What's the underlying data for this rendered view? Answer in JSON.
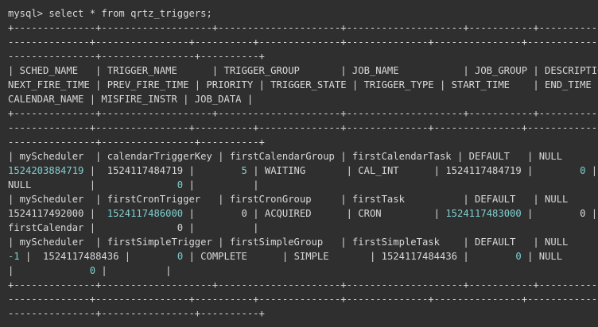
{
  "terminal": {
    "lines": [
      [
        {
          "text": "mysql> select * from qrtz_triggers;",
          "kind": "plain"
        }
      ],
      [
        {
          "text": "+--------------+-------------------+---------------------+--------------------+-----------+-------------+",
          "kind": "plain"
        }
      ],
      [
        {
          "text": "--------------+----------------+----------+--------------+--------------+---------------+---------------+",
          "kind": "plain"
        }
      ],
      [
        {
          "text": "---------------+----------------+----------+",
          "kind": "plain"
        }
      ],
      [
        {
          "text": "| SCHED_NAME   | TRIGGER_NAME      | TRIGGER_GROUP       | JOB_NAME           | JOB_GROUP | DESCRIPTION |",
          "kind": "plain"
        }
      ],
      [
        {
          "text": "NEXT_FIRE_TIME | PREV_FIRE_TIME | PRIORITY | TRIGGER_STATE | TRIGGER_TYPE | START_TIME    | END_TIME |",
          "kind": "plain"
        }
      ],
      [
        {
          "text": "CALENDAR_NAME | MISFIRE_INSTR | JOB_DATA |",
          "kind": "plain"
        }
      ],
      [
        {
          "text": "+--------------+-------------------+---------------------+--------------------+-----------+-------------+",
          "kind": "plain"
        }
      ],
      [
        {
          "text": "--------------+----------------+----------+--------------+--------------+---------------+---------------+",
          "kind": "plain"
        }
      ],
      [
        {
          "text": "---------------+----------------+----------+",
          "kind": "plain"
        }
      ],
      [
        {
          "text": "| myScheduler  | calendarTriggerKey | firstCalendarGroup | firstCalendarTask | DEFAULT   | NULL        |",
          "kind": "plain"
        }
      ],
      [
        {
          "text": "1524203884719",
          "kind": "number"
        },
        {
          "text": " |  1524117484719 |        ",
          "kind": "plain"
        },
        {
          "text": "5",
          "kind": "number"
        },
        {
          "text": " | WAITING       | CAL_INT      | 1524117484719 |        ",
          "kind": "plain"
        },
        {
          "text": "0",
          "kind": "number"
        },
        {
          "text": " |",
          "kind": "plain"
        }
      ],
      [
        {
          "text": "NULL          |              ",
          "kind": "plain"
        },
        {
          "text": "0",
          "kind": "number"
        },
        {
          "text": " |          |",
          "kind": "plain"
        }
      ],
      [
        {
          "text": "| myScheduler  | firstCronTrigger   | firstCronGroup     | firstTask          | DEFAULT   | NULL        |",
          "kind": "plain"
        }
      ],
      [
        {
          "text": "1524117492000 |  ",
          "kind": "plain"
        },
        {
          "text": "1524117486000",
          "kind": "number"
        },
        {
          "text": " |        0 | ACQUIRED      | CRON         | ",
          "kind": "plain"
        },
        {
          "text": "1524117483000",
          "kind": "number"
        },
        {
          "text": " |        0 |",
          "kind": "plain"
        }
      ],
      [
        {
          "text": "firstCalendar |              0 |          |",
          "kind": "plain"
        }
      ],
      [
        {
          "text": "| myScheduler  | firstSimpleTrigger | firstSimpleGroup   | firstSimpleTask    | DEFAULT   | NULL        |",
          "kind": "plain"
        }
      ],
      [
        {
          "text": "-1",
          "kind": "number"
        },
        {
          "text": " |  1524117488436 |        ",
          "kind": "plain"
        },
        {
          "text": "0",
          "kind": "number"
        },
        {
          "text": " | COMPLETE      | SIMPLE       | 1524117484436 |        ",
          "kind": "plain"
        },
        {
          "text": "0",
          "kind": "number"
        },
        {
          "text": " | NULL",
          "kind": "plain"
        }
      ],
      [
        {
          "text": "|             ",
          "kind": "plain"
        },
        {
          "text": "0",
          "kind": "number"
        },
        {
          "text": " |          |",
          "kind": "plain"
        }
      ],
      [
        {
          "text": "+--------------+-------------------+---------------------+--------------------+-----------+-------------+",
          "kind": "plain"
        }
      ],
      [
        {
          "text": "--------------+----------------+----------+--------------+--------------+---------------+---------------+",
          "kind": "plain"
        }
      ],
      [
        {
          "text": "---------------+----------------+----------+",
          "kind": "plain"
        }
      ]
    ]
  }
}
